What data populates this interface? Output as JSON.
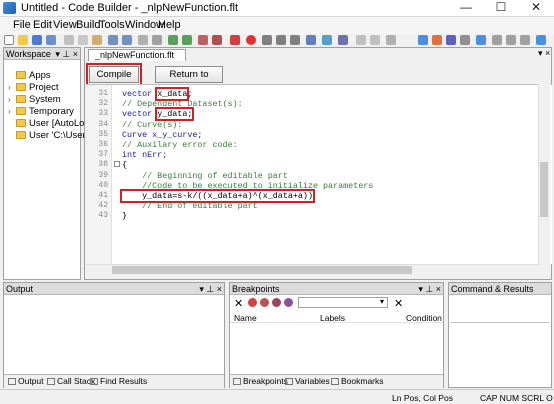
{
  "window": {
    "title": "Untitled - Code Builder - _nlpNewFunction.flt",
    "minimize": "—",
    "maximize": "☐",
    "close": "✕"
  },
  "menu": [
    "File",
    "Edit",
    "View",
    "Build",
    "Tools",
    "Window",
    "Help"
  ],
  "workspace": {
    "title": "Workspace",
    "pin": "▾ ⊥ ×",
    "items": [
      {
        "label": "Apps",
        "expandable": false
      },
      {
        "label": "Project",
        "expandable": true
      },
      {
        "label": "System",
        "expandable": true
      },
      {
        "label": "Temporary",
        "expandable": true
      },
      {
        "label": "User  [AutoLoa",
        "expandable": false
      },
      {
        "label": "User  'C:\\Users\\",
        "expandable": false
      }
    ]
  },
  "editor": {
    "tab_label": "_nlpNewFunction.flt",
    "close": "▾ ×",
    "compile_label": "Compile",
    "return_label": "Return to Dialog",
    "lines": [
      {
        "num": "31",
        "parts": [
          {
            "t": "vector ",
            "c": "kw"
          },
          {
            "t": "x_data",
            "c": "hl"
          },
          {
            "t": ";",
            "c": ""
          }
        ]
      },
      {
        "num": "32",
        "parts": [
          {
            "t": "// Dependent Dataset(s):",
            "c": "cm"
          }
        ]
      },
      {
        "num": "33",
        "parts": [
          {
            "t": "vector ",
            "c": "kw"
          },
          {
            "t": "y_data;",
            "c": "hl"
          }
        ]
      },
      {
        "num": "34",
        "parts": [
          {
            "t": "// Curve(s):",
            "c": "cm"
          }
        ]
      },
      {
        "num": "35",
        "parts": [
          {
            "t": "Curve x_y_curve;",
            "c": "kw"
          }
        ]
      },
      {
        "num": "36",
        "parts": [
          {
            "t": "// Auxilary error code:",
            "c": "cm"
          }
        ]
      },
      {
        "num": "37",
        "parts": [
          {
            "t": "int nErr;",
            "c": "kw"
          }
        ]
      },
      {
        "num": "38",
        "parts": [
          {
            "t": "{",
            "c": ""
          }
        ]
      },
      {
        "num": "39",
        "parts": [
          {
            "t": "    // Beginning of editable part",
            "c": "cm"
          }
        ]
      },
      {
        "num": "40",
        "parts": [
          {
            "t": "    //Code to be executed to initialize parameters",
            "c": "cm"
          }
        ]
      },
      {
        "num": "41",
        "parts": [
          {
            "t": "    y_data=s-k/((x_data+a)^(x_data+a))",
            "c": "hl"
          }
        ]
      },
      {
        "num": "42",
        "parts": [
          {
            "t": "    // End of editable part",
            "c": "cm"
          }
        ]
      },
      {
        "num": "43",
        "parts": [
          {
            "t": "}",
            "c": ""
          }
        ]
      }
    ]
  },
  "output": {
    "title": "Output",
    "tabs": [
      "Output",
      "Call Stack",
      "Find Results"
    ]
  },
  "breakpoints": {
    "title": "Breakpoints",
    "columns": [
      "Name",
      "Labels",
      "Condition"
    ],
    "tabs": [
      "Breakpoints",
      "Variables",
      "Bookmarks"
    ]
  },
  "command": {
    "title": "Command & Results"
  },
  "status": {
    "position": "Ln Pos, Col Pos",
    "indicators": "CAP  NUM  SCRL  O"
  },
  "colors": {
    "highlight": "#d42020",
    "keyword": "#1a1aa6",
    "comment": "#3c7a3c"
  }
}
